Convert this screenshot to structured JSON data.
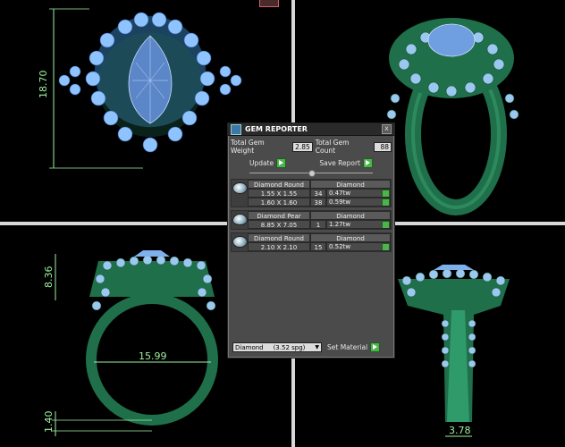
{
  "viewports": {
    "top_left": {
      "dimension": "18.70"
    },
    "bottom_left": {
      "dim_top": "8.36",
      "dim_mid": "15.99",
      "dim_bottom": "1.40"
    },
    "bottom_right": {
      "dim_bottom": "3.78"
    }
  },
  "gem_reporter": {
    "title": "GEM REPORTER",
    "close_label": "x",
    "total_weight_label": "Total Gem Weight",
    "total_weight_value": "2.85",
    "total_count_label": "Total Gem Count",
    "total_count_value": "88",
    "update_label": "Update",
    "save_report_label": "Save Report",
    "groups": [
      {
        "shape": "Diamond Round",
        "material": "Diamond",
        "rows": [
          {
            "size": "1.55 X 1.55",
            "count": "34",
            "weight": "0.47tw"
          },
          {
            "size": "1.60 X 1.60",
            "count": "38",
            "weight": "0.59tw"
          }
        ]
      },
      {
        "shape": "Diamond Pear",
        "material": "Diamond",
        "rows": [
          {
            "size": "8.85 X 7.05",
            "count": "1",
            "weight": "1.27tw"
          }
        ]
      },
      {
        "shape": "Diamond Round",
        "material": "Diamond",
        "rows": [
          {
            "size": "2.10 X 2.10",
            "count": "15",
            "weight": "0.52tw"
          }
        ]
      }
    ],
    "material_select": "Diamond",
    "material_sg": "(3.52 spg)",
    "set_material_label": "Set Material"
  },
  "colors": {
    "ring": "#1f6f4a",
    "gem": "#7fb6f2",
    "dimension": "#9ff29f"
  }
}
